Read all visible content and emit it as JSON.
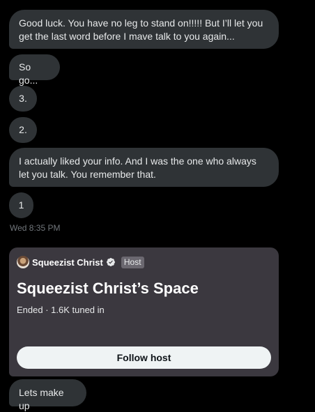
{
  "messages": [
    {
      "text": "Good luck.  You have no leg to stand on!!!!!    But I’ll let you get the last word before I mave talk to you again..."
    },
    {
      "text": "So go..."
    },
    {
      "text": "3."
    },
    {
      "text": "2."
    },
    {
      "text": "I actually liked your info.  And I was the one who always let you talk.  You remember that."
    },
    {
      "text": "1"
    }
  ],
  "timestamp": "Wed 8:35 PM",
  "space_card": {
    "host_name": "Squeezist Christ",
    "host_badge": "Host",
    "title": "Squeezist Christ’s Space",
    "status": "Ended · 1.6K tuned in",
    "follow_label": "Follow host"
  },
  "last_message": {
    "text": "Lets make up"
  },
  "colors": {
    "background": "#000000",
    "bubble": "#2f3336",
    "card": "#3b383f",
    "verified": "#9aa0a6"
  }
}
